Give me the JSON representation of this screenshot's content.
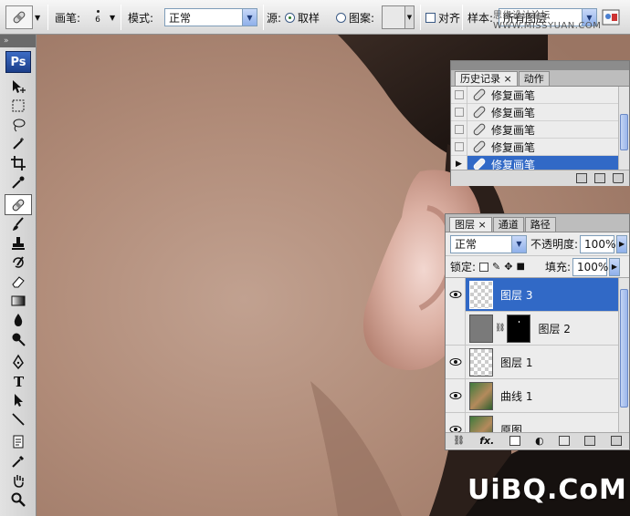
{
  "options_bar": {
    "brush_label": "画笔:",
    "brush_size": "6",
    "mode_label": "模式:",
    "mode_value": "正常",
    "source_label": "源:",
    "sampled_label": "取样",
    "pattern_label": "图案:",
    "aligned_label": "对齐",
    "sample_label": "样本:",
    "sample_value": "所有图层"
  },
  "watermark_top": "思缘设计论坛 WWW.MISSYUAN.COM",
  "toolbox": {
    "logo": "Ps"
  },
  "history_panel": {
    "tabs": [
      {
        "label": "历史记录",
        "active": true,
        "close": "×"
      },
      {
        "label": "动作",
        "active": false,
        "close": ""
      }
    ],
    "items": [
      {
        "label": "修复画笔",
        "selected": false
      },
      {
        "label": "修复画笔",
        "selected": false
      },
      {
        "label": "修复画笔",
        "selected": false
      },
      {
        "label": "修复画笔",
        "selected": false
      },
      {
        "label": "修复画笔",
        "selected": true
      }
    ]
  },
  "layers_panel": {
    "tabs": [
      {
        "label": "图层",
        "active": true,
        "close": "×"
      },
      {
        "label": "通道",
        "active": false,
        "close": ""
      },
      {
        "label": "路径",
        "active": false,
        "close": ""
      }
    ],
    "blend_mode": "正常",
    "opacity_label": "不透明度:",
    "opacity_value": "100%",
    "lock_label": "锁定:",
    "fill_label": "填充:",
    "fill_value": "100%",
    "layers": [
      {
        "name": "图层 3",
        "selected": true
      },
      {
        "name": "图层 2",
        "selected": false
      },
      {
        "name": "图层 1",
        "selected": false
      },
      {
        "name": "曲线 1",
        "selected": false
      },
      {
        "name": "原图",
        "selected": false
      }
    ],
    "footer_fx": "fx."
  },
  "watermark": "UiBQ.CoM",
  "colors": {
    "selection": "#3169c6",
    "green_backdrop": "#2f7d3a",
    "skin": "#b38e7b"
  }
}
